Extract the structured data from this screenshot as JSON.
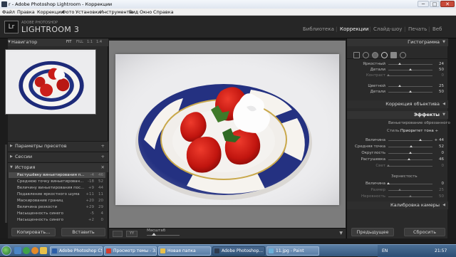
{
  "window": {
    "title": "r - Adobe Photoshop Lightroom - Коррекции",
    "min": "─",
    "max": "□",
    "close": "✕"
  },
  "menu": [
    "Файл",
    "Правка",
    "Коррекции",
    "Фото",
    "Установки",
    "Инструменты",
    "Вид",
    "Окно",
    "Справка"
  ],
  "brand": {
    "badge": "Lr",
    "top": "ADOBE PHOTOSHOP",
    "name": "LIGHTROOM 3"
  },
  "modules": [
    {
      "label": "Библиотека",
      "active": false
    },
    {
      "label": "Коррекции",
      "active": true
    },
    {
      "label": "Слайд-шоу",
      "active": false
    },
    {
      "label": "Печать",
      "active": false
    },
    {
      "label": "Веб",
      "active": false
    }
  ],
  "navigator": {
    "title": "Навигатор",
    "options": [
      "FIT",
      "FILL",
      "1:1",
      "1:4"
    ]
  },
  "left_sections": {
    "presets": "Параметры пресетов",
    "sessions": "Сессии",
    "history": "История",
    "add": "+"
  },
  "history": [
    {
      "label": "Растушёвку виньетирования п...",
      "v1": "-4",
      "v2": "46",
      "selected": true
    },
    {
      "label": "Среднюю точку виньетирован...",
      "v1": "-18",
      "v2": "52",
      "selected": false
    },
    {
      "label": "Величину виньетирования пос...",
      "v1": "+9",
      "v2": "44",
      "selected": false
    },
    {
      "label": "Подавление яркостного шума",
      "v1": "+11",
      "v2": "11",
      "selected": false
    },
    {
      "label": "Маскирование границ",
      "v1": "+20",
      "v2": "20",
      "selected": false
    },
    {
      "label": "Величина резкости",
      "v1": "+29",
      "v2": "29",
      "selected": false
    },
    {
      "label": "Насыщенность синего",
      "v1": "-5",
      "v2": "4",
      "selected": false
    },
    {
      "label": "Насыщенность синего",
      "v1": "+2",
      "v2": "0",
      "selected": false
    }
  ],
  "left_buttons": {
    "copy": "Копировать...",
    "paste": "Вставить"
  },
  "toolbar": {
    "zoom_label": "Масштаб",
    "view_btn": "YY"
  },
  "right": {
    "histogram": "Гистограмма",
    "noise_rows": [
      {
        "label": "Яркостный",
        "value": "24",
        "pos": 0.25,
        "dim": false
      },
      {
        "label": "Детали",
        "value": "50",
        "pos": 0.5,
        "dim": false
      },
      {
        "label": "Контраст",
        "value": "0",
        "pos": 0.0,
        "dim": true
      }
    ],
    "color_rows": [
      {
        "label": "Цветной",
        "value": "25",
        "pos": 0.25,
        "dim": false
      },
      {
        "label": "Детали",
        "value": "50",
        "pos": 0.5,
        "dim": false
      }
    ],
    "lens": "Коррекция объектива",
    "effects": "Эффекты",
    "vignette_title": "Виньетирование обрезанного",
    "style_label": "Стиль:",
    "style_value": "Приоритет тона ÷",
    "vignette_rows": [
      {
        "label": "Величина",
        "value": "+ 44",
        "pos": 0.72,
        "dim": false
      },
      {
        "label": "Средняя точка",
        "value": "52",
        "pos": 0.52,
        "dim": false
      },
      {
        "label": "Округлость",
        "value": "0",
        "pos": 0.5,
        "dim": false
      },
      {
        "label": "Растушевка",
        "value": "46",
        "pos": 0.46,
        "dim": false
      },
      {
        "label": "Свет",
        "value": "0",
        "pos": 0.0,
        "dim": true
      }
    ],
    "grain_title": "Зернистость",
    "grain_rows": [
      {
        "label": "Величина",
        "value": "0",
        "pos": 0.0,
        "dim": false
      },
      {
        "label": "Размер",
        "value": "25",
        "pos": 0.25,
        "dim": true
      },
      {
        "label": "Неровность",
        "value": "50",
        "pos": 0.5,
        "dim": true
      }
    ],
    "calibration": "Калибровка камеры",
    "prev_btn": "Предыдущее",
    "reset_btn": "Сбросить"
  },
  "taskbar": {
    "tasks": [
      {
        "label": "Adobe Photoshop CS4",
        "active": false,
        "color": "#2c5ea8"
      },
      {
        "label": "Просмотр темы - З...",
        "active": false,
        "color": "#d33b2c"
      },
      {
        "label": "Новая папка",
        "active": false,
        "color": "#e8c14a"
      },
      {
        "label": "Adobe Photoshop...",
        "active": true,
        "color": "#2e3b4e"
      },
      {
        "label": "11.jpg - Paint",
        "active": false,
        "color": "#6ab0d8"
      }
    ],
    "lang": "EN",
    "time": "21:57"
  }
}
